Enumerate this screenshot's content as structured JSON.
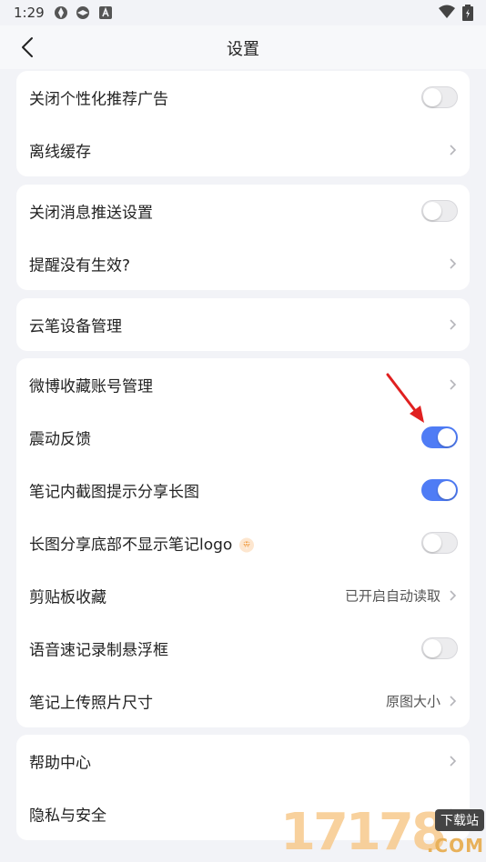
{
  "status_bar": {
    "time": "1:29"
  },
  "header": {
    "title": "设置"
  },
  "sections": [
    {
      "rows": [
        {
          "label": "关闭个性化推荐广告",
          "control": "toggle",
          "on": false
        },
        {
          "label": "离线缓存",
          "control": "chevron"
        }
      ]
    },
    {
      "rows": [
        {
          "label": "关闭消息推送设置",
          "control": "toggle",
          "on": false
        },
        {
          "label": "提醒没有生效?",
          "control": "chevron"
        }
      ]
    },
    {
      "rows": [
        {
          "label": "云笔设备管理",
          "control": "chevron"
        }
      ]
    },
    {
      "rows": [
        {
          "label": "微博收藏账号管理",
          "control": "chevron"
        },
        {
          "label": "震动反馈",
          "control": "toggle",
          "on": true
        },
        {
          "label": "笔记内截图提示分享长图",
          "control": "toggle",
          "on": true
        },
        {
          "label": "长图分享底部不显示笔记logo",
          "control": "toggle",
          "on": false,
          "badge": "vip-diamond-icon"
        },
        {
          "label": "剪贴板收藏",
          "control": "chevron",
          "value": "已开启自动读取"
        },
        {
          "label": "语音速记录制悬浮框",
          "control": "toggle",
          "on": false
        },
        {
          "label": "笔记上传照片尺寸",
          "control": "chevron",
          "value": "原图大小"
        }
      ]
    },
    {
      "rows": [
        {
          "label": "帮助中心",
          "control": "chevron"
        },
        {
          "label": "隐私与安全",
          "control": "chevron"
        }
      ]
    }
  ],
  "watermark": {
    "number": "17178",
    "download": "下载站",
    "domain": ".COM"
  },
  "colors": {
    "toggle_on": "#4f7cf5",
    "background": "#f2f3f7",
    "card": "#ffffff",
    "arrow": "#e02020"
  }
}
